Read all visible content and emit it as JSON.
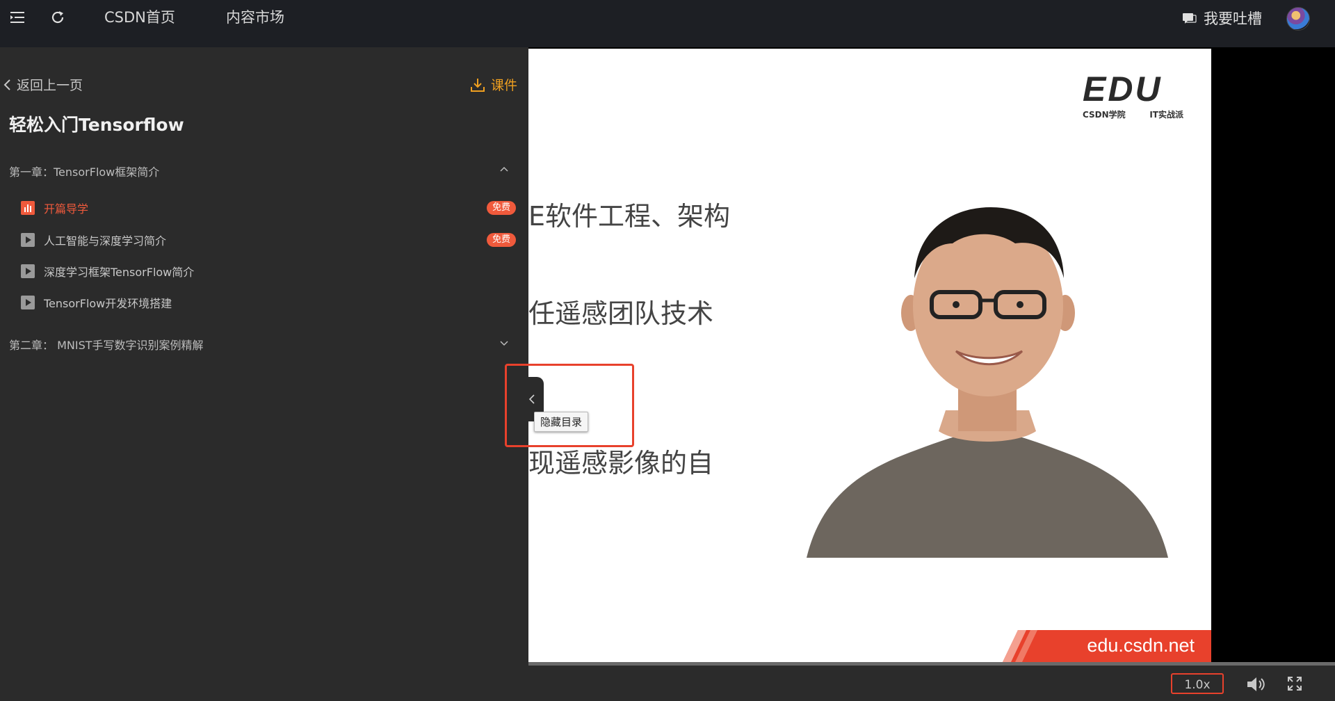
{
  "topbar": {
    "nav_home": "CSDN首页",
    "nav_market": "内容市场",
    "feedback": "我要吐槽"
  },
  "sidebar": {
    "back": "返回上一页",
    "download": "课件",
    "course_title": "轻松入门Tensorflow",
    "chapters": [
      {
        "title": "第一章：TensorFlow框架简介",
        "expanded": true,
        "lessons": [
          {
            "title": "开篇导学",
            "badge": "免费",
            "active": true
          },
          {
            "title": "人工智能与深度学习简介",
            "badge": "免费"
          },
          {
            "title": "深度学习框架TensorFlow简介"
          },
          {
            "title": "TensorFlow开发环境搭建"
          }
        ]
      },
      {
        "title": "第二章： MNIST手写数字识别案例精解",
        "expanded": false
      }
    ]
  },
  "video": {
    "logo_main": "EDU",
    "logo_left": "CSDN学院",
    "logo_right": "IT实战派",
    "slide_lines": [
      "E软件工程、架构",
      "任遥感团队技术",
      "现遥感影像的自"
    ],
    "site_url": "edu.csdn.net"
  },
  "toggle_tooltip": "隐藏目录",
  "controls": {
    "speed": "1.0x",
    "progress": 0.0
  },
  "colors": {
    "accent": "#f05a3c",
    "download": "#f0a020",
    "highlight": "#e8412c"
  }
}
